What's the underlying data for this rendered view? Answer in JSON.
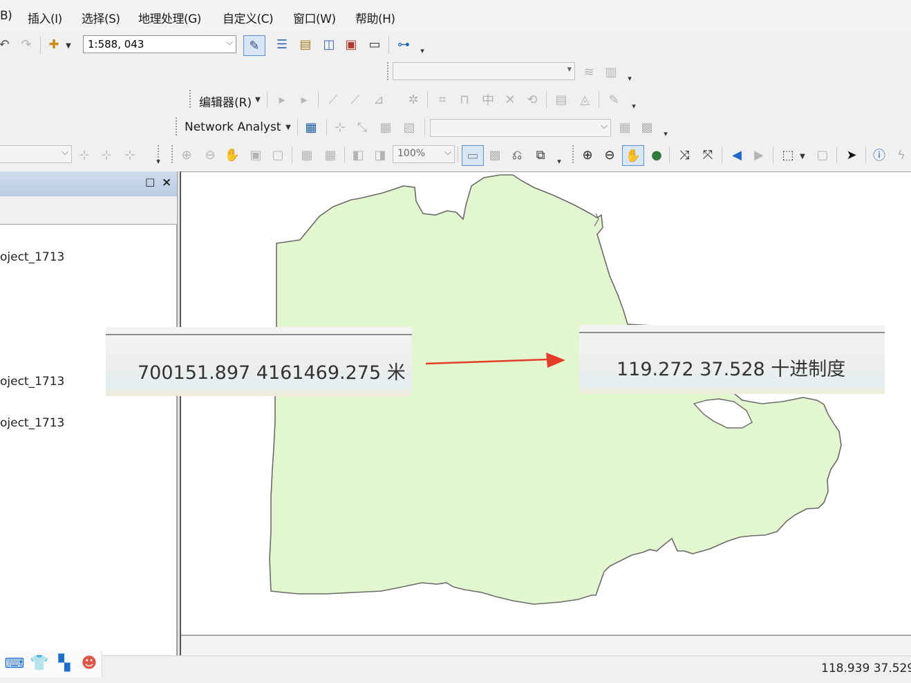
{
  "menu": [
    "B)",
    "插入(I)",
    "选择(S)",
    "地理处理(G)",
    "自定义(C)",
    "窗口(W)",
    "帮助(H)"
  ],
  "standard_toolbar": {
    "scale": "1:588, 043"
  },
  "editor_toolbar": {
    "label": "编辑器(R)"
  },
  "network_toolbar": {
    "label": "Network Analyst"
  },
  "layout_toolbar": {
    "zoom": "100%"
  },
  "toc": {
    "close": "×",
    "items": [
      "oject_1713",
      "oject_1713",
      "oject_1713"
    ]
  },
  "callout_left": {
    "value": "700151.897  4161469.275 米"
  },
  "callout_right": {
    "value": "119.272  37.528 十进制度"
  },
  "status": {
    "coords": "118.939  37.529"
  },
  "colors": {
    "polygon_fill": "#e2f7cf",
    "polygon_stroke": "#6a6a6a",
    "arrow": "#e53b2b",
    "toc_header": "#c4d4ea"
  }
}
